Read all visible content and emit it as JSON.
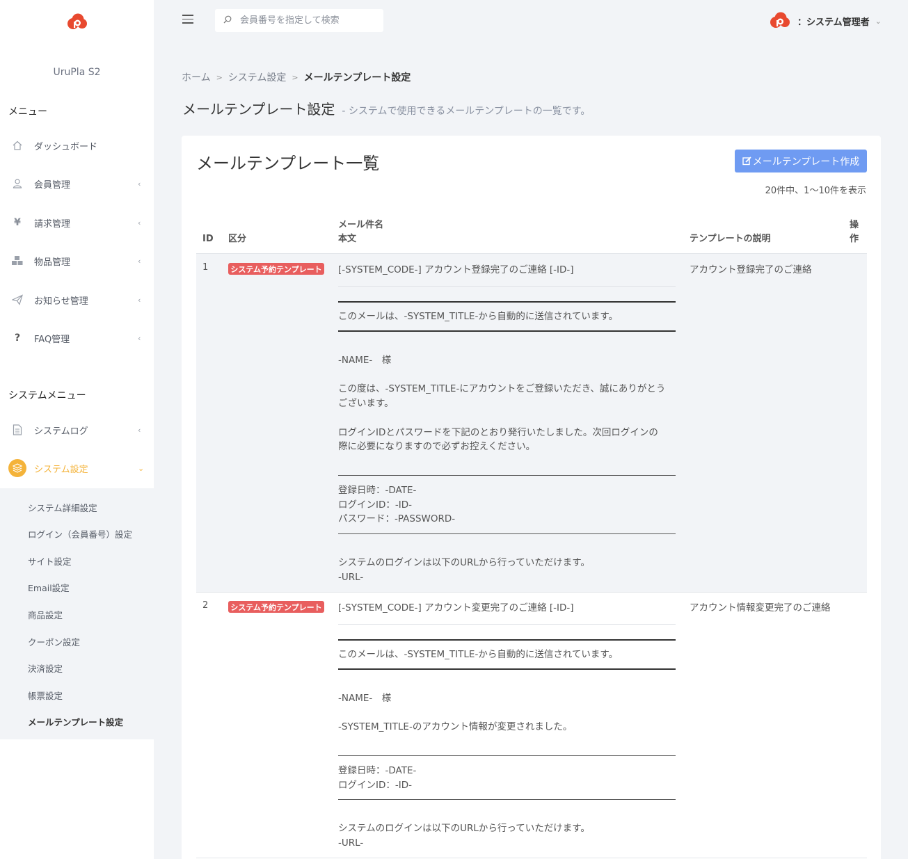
{
  "app": {
    "brand": "UruPla S2"
  },
  "sidebar": {
    "menu_title": "メニュー",
    "items": [
      {
        "label": "ダッシュボード",
        "icon": "home-icon"
      },
      {
        "label": "会員管理",
        "icon": "user-icon"
      },
      {
        "label": "請求管理",
        "icon": "yen-icon"
      },
      {
        "label": "物品管理",
        "icon": "cubes-icon"
      },
      {
        "label": "お知らせ管理",
        "icon": "send-icon"
      },
      {
        "label": "FAQ管理",
        "icon": "question-icon"
      }
    ],
    "system_menu_title": "システムメニュー",
    "system_items": [
      {
        "label": "システムログ",
        "icon": "document-icon"
      },
      {
        "label": "システム設定",
        "icon": "layers-icon",
        "active": true
      }
    ],
    "submenu": [
      "システム詳細設定",
      "ログイン（会員番号）設定",
      "サイト設定",
      "Email設定",
      "商品設定",
      "クーポン設定",
      "決済設定",
      "帳票設定",
      "メールテンプレート設定"
    ]
  },
  "topbar": {
    "search_placeholder": "会員番号を指定して検索",
    "user_name": "：システム管理者"
  },
  "breadcrumb": {
    "home": "ホーム",
    "parent": "システム設定",
    "current": "メールテンプレート設定"
  },
  "page": {
    "title": "メールテンプレート設定",
    "subtitle": "- システムで使用できるメールテンプレートの一覧です。"
  },
  "card": {
    "title": "メールテンプレート一覧",
    "create_button": "メールテンプレート作成",
    "count_text": "20件中、1〜10件を表示"
  },
  "table": {
    "headers": {
      "id": "ID",
      "category": "区分",
      "subject": "メール件名",
      "body": "本文",
      "description": "テンプレートの説明",
      "action_1": "操",
      "action_2": "作"
    },
    "rows": [
      {
        "id": "1",
        "category": "システム予約テンプレート",
        "subject": "[-SYSTEM_CODE-] アカウント登録完了のご連絡 [-ID-]",
        "description": "アカウント登録完了のご連絡",
        "body": {
          "auto_notice": "このメールは、-SYSTEM_TITLE-から自動的に送信されています。",
          "greeting": "-NAME-　様",
          "para1_l1": "この度は、-SYSTEM_TITLE-にアカウントをご登録いただき、誠にありがとう",
          "para1_l2": "ございます。",
          "para2_l1": "ログインIDとパスワードを下記のとおり発行いたしました。次回ログインの",
          "para2_l2": "際に必要になりますので必ずお控えください。",
          "date": "登録日時：-DATE-",
          "login_id": "ログインID：-ID-",
          "password": "パスワード：-PASSWORD-",
          "login_note": "システムのログインは以下のURLから行っていただけます。",
          "url": "-URL-"
        }
      },
      {
        "id": "2",
        "category": "システム予約テンプレート",
        "subject": "[-SYSTEM_CODE-] アカウント変更完了のご連絡 [-ID-]",
        "description": "アカウント情報変更完了のご連絡",
        "body": {
          "auto_notice": "このメールは、-SYSTEM_TITLE-から自動的に送信されています。",
          "greeting": "-NAME-　様",
          "para1_l1": "-SYSTEM_TITLE-のアカウント情報が変更されました。",
          "date": "登録日時：-DATE-",
          "login_id": "ログインID：-ID-",
          "login_note": "システムのログインは以下のURLから行っていただけます。",
          "url": "-URL-"
        }
      }
    ]
  },
  "colors": {
    "accent": "#f4b33a",
    "primary_button": "#6f9bf2",
    "badge": "#e85e5e",
    "logo": "#e8492f"
  }
}
